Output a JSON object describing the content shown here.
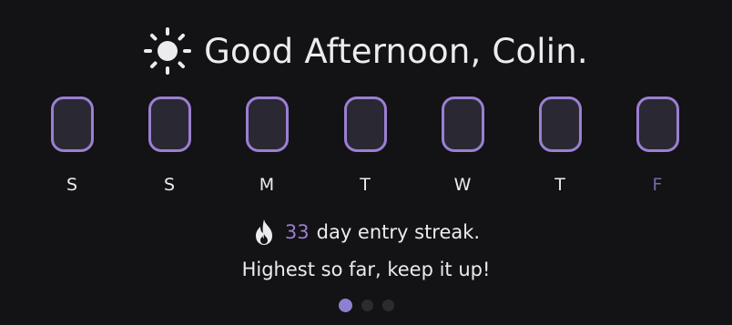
{
  "greeting": {
    "icon": "sun-icon",
    "text": "Good Afternoon, Colin."
  },
  "week": {
    "days": [
      {
        "letter": "S",
        "today": false
      },
      {
        "letter": "S",
        "today": false
      },
      {
        "letter": "M",
        "today": false
      },
      {
        "letter": "T",
        "today": false
      },
      {
        "letter": "W",
        "today": false
      },
      {
        "letter": "T",
        "today": false
      },
      {
        "letter": "F",
        "today": true
      }
    ]
  },
  "streak": {
    "icon": "flame-icon",
    "count": "33",
    "text": "day entry streak."
  },
  "motivation": "Highest so far, keep it up!",
  "pager": {
    "pages": 3,
    "active_index": 0
  },
  "colors": {
    "background": "#131214",
    "accent": "#9a7fd2",
    "today_letter": "#7a6aa8",
    "pill_fill": "#2a2832",
    "text": "#ecebee"
  }
}
